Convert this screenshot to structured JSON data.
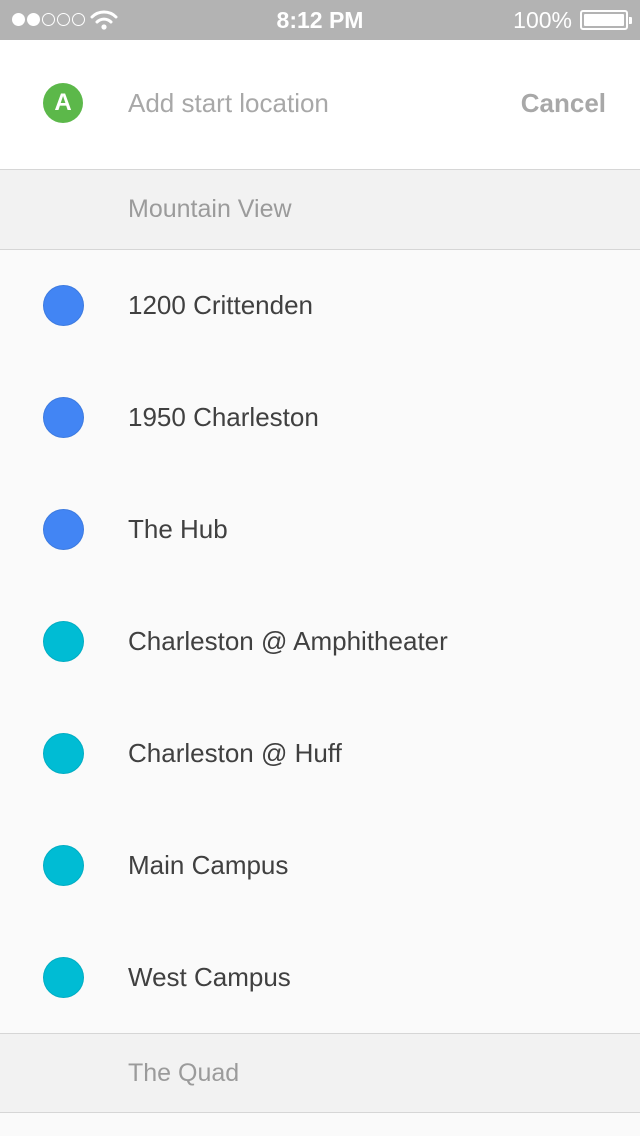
{
  "status_bar": {
    "time": "8:12 PM",
    "battery": "100%",
    "signal_bars_filled": 2,
    "signal_bars_total": 5,
    "battery_level": 1.0
  },
  "search": {
    "badge_letter": "A",
    "badge_color": "#5cb84a",
    "placeholder": "Add start location",
    "value": "",
    "cancel_label": "Cancel"
  },
  "sections": [
    {
      "title": "Mountain View",
      "stops": [
        {
          "label": "1200 Crittenden",
          "color": "#4285f4"
        },
        {
          "label": "1950 Charleston",
          "color": "#4285f4"
        },
        {
          "label": "The Hub",
          "color": "#4285f4"
        },
        {
          "label": "Charleston @ Amphitheater",
          "color": "#00bcd4"
        },
        {
          "label": "Charleston @ Huff",
          "color": "#00bcd4"
        },
        {
          "label": "Main Campus",
          "color": "#00bcd4"
        },
        {
          "label": "West Campus",
          "color": "#00bcd4"
        }
      ]
    },
    {
      "title": "The Quad",
      "stops": []
    }
  ],
  "icons": {
    "signal": "signal-dots-icon",
    "wifi": "wifi-icon",
    "battery": "battery-icon",
    "badge": "start-marker-icon",
    "stop": "stop-dot-icon"
  }
}
